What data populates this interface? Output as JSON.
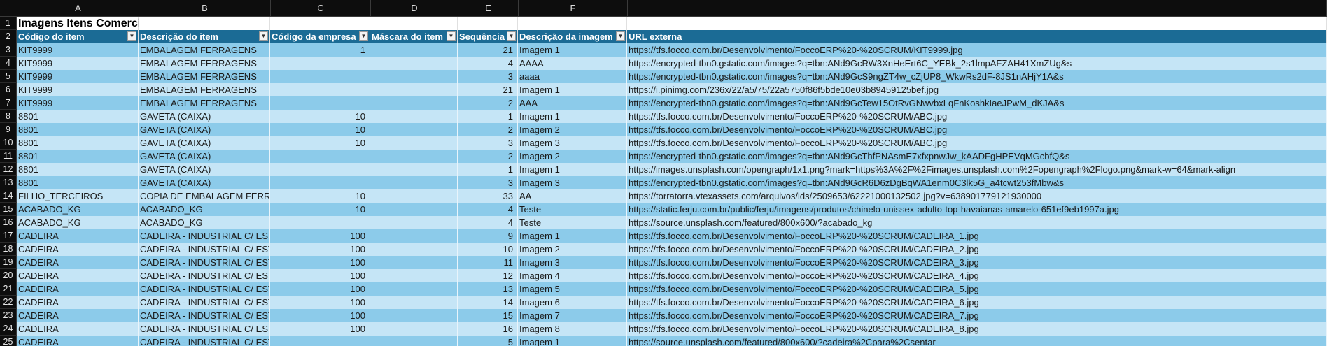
{
  "columns": [
    "A",
    "B",
    "C",
    "D",
    "E",
    "F",
    ""
  ],
  "title": "Imagens Itens Comerciais",
  "headers": [
    "Código do item",
    "Descrição do item",
    "Código da empresa",
    "Máscara do item",
    "Sequência",
    "Descrição da imagem",
    "URL externa"
  ],
  "header_dropdown_icon": "dropdown-arrow-icon",
  "colors": {
    "header_bg": "#1b6b95",
    "band_dark": "#8ccbea",
    "band_light": "#c5e5f6",
    "row_header_bg": "#0d0d0d"
  },
  "rows": [
    {
      "n": "3",
      "cells": [
        "KIT9999",
        "EMBALAGEM FERRAGENS",
        "1",
        "",
        "21",
        "Imagem 1",
        "https://tfs.focco.com.br/Desenvolvimento/FoccoERP%20-%20SCRUM/KIT9999.jpg"
      ]
    },
    {
      "n": "4",
      "cells": [
        "KIT9999",
        "EMBALAGEM FERRAGENS",
        "",
        "",
        "4",
        "AAAA",
        "https://encrypted-tbn0.gstatic.com/images?q=tbn:ANd9GcRW3XnHeErt6C_YEBk_2s1lmpAFZAH41XmZUg&s"
      ]
    },
    {
      "n": "5",
      "cells": [
        "KIT9999",
        "EMBALAGEM FERRAGENS",
        "",
        "",
        "3",
        "aaaa",
        "https://encrypted-tbn0.gstatic.com/images?q=tbn:ANd9GcS9ngZT4w_cZjUP8_WkwRs2dF-8JS1nAHjY1A&s"
      ]
    },
    {
      "n": "6",
      "cells": [
        "KIT9999",
        "EMBALAGEM FERRAGENS",
        "",
        "",
        "21",
        "Imagem 1",
        "https://i.pinimg.com/236x/22/a5/75/22a5750f86f5bde10e03b89459125bef.jpg"
      ]
    },
    {
      "n": "7",
      "cells": [
        "KIT9999",
        "EMBALAGEM FERRAGENS",
        "",
        "",
        "2",
        "AAA",
        "https://encrypted-tbn0.gstatic.com/images?q=tbn:ANd9GcTew15OtRvGNwvbxLqFnKoshkIaeJPwM_dKJA&s"
      ]
    },
    {
      "n": "8",
      "cells": [
        "8801",
        "GAVETA (CAIXA)",
        "10",
        "",
        "1",
        "Imagem 1",
        "https://tfs.focco.com.br/Desenvolvimento/FoccoERP%20-%20SCRUM/ABC.jpg"
      ]
    },
    {
      "n": "9",
      "cells": [
        "8801",
        "GAVETA (CAIXA)",
        "10",
        "",
        "2",
        "Imagem 2",
        "https://tfs.focco.com.br/Desenvolvimento/FoccoERP%20-%20SCRUM/ABC.jpg"
      ]
    },
    {
      "n": "10",
      "cells": [
        "8801",
        "GAVETA (CAIXA)",
        "10",
        "",
        "3",
        "Imagem 3",
        "https://tfs.focco.com.br/Desenvolvimento/FoccoERP%20-%20SCRUM/ABC.jpg"
      ]
    },
    {
      "n": "11",
      "cells": [
        "8801",
        "GAVETA (CAIXA)",
        "",
        "",
        "2",
        "Imagem 2",
        "https://encrypted-tbn0.gstatic.com/images?q=tbn:ANd9GcThfPNAsmE7xfxpnwJw_kAADFgHPEVqMGcbfQ&s"
      ]
    },
    {
      "n": "12",
      "cells": [
        "8801",
        "GAVETA (CAIXA)",
        "",
        "",
        "1",
        "Imagem 1",
        "https://images.unsplash.com/opengraph/1x1.png?mark=https%3A%2F%2Fimages.unsplash.com%2Fopengraph%2Flogo.png&mark-w=64&mark-align"
      ]
    },
    {
      "n": "13",
      "cells": [
        "8801",
        "GAVETA (CAIXA)",
        "",
        "",
        "3",
        "Imagem 3",
        "https://encrypted-tbn0.gstatic.com/images?q=tbn:ANd9GcR6D6zDgBqWA1enm0C3lk5G_a4tcwt253fMbw&s"
      ]
    },
    {
      "n": "14",
      "cells": [
        "FILHO_TERCEIROS",
        "COPIA DE EMBALAGEM FERRAGENS",
        "10",
        "",
        "33",
        "AA",
        "https://torratorra.vtexassets.com/arquivos/ids/2509653/62221000132502.jpg?v=638901779121930000"
      ]
    },
    {
      "n": "15",
      "cells": [
        "ACABADO_KG",
        "ACABADO_KG",
        "10",
        "",
        "4",
        "Teste",
        "https://static.ferju.com.br/public/ferju/imagens/produtos/chinelo-unissex-adulto-top-havaianas-amarelo-651ef9eb1997a.jpg"
      ]
    },
    {
      "n": "16",
      "cells": [
        "ACABADO_KG",
        "ACABADO_KG",
        "",
        "",
        "4",
        "Teste",
        "https://source.unsplash.com/featured/800x600/?acabado_kg"
      ]
    },
    {
      "n": "17",
      "cells": [
        "CADEIRA",
        "CADEIRA - INDUSTRIAL C/ ESTR",
        "100",
        "",
        "9",
        "Imagem 1",
        "https://tfs.focco.com.br/Desenvolvimento/FoccoERP%20-%20SCRUM/CADEIRA_1.jpg"
      ]
    },
    {
      "n": "18",
      "cells": [
        "CADEIRA",
        "CADEIRA - INDUSTRIAL C/ ESTR",
        "100",
        "",
        "10",
        "Imagem 2",
        "https://tfs.focco.com.br/Desenvolvimento/FoccoERP%20-%20SCRUM/CADEIRA_2.jpg"
      ]
    },
    {
      "n": "19",
      "cells": [
        "CADEIRA",
        "CADEIRA - INDUSTRIAL C/ ESTR",
        "100",
        "",
        "11",
        "Imagem 3",
        "https://tfs.focco.com.br/Desenvolvimento/FoccoERP%20-%20SCRUM/CADEIRA_3.jpg"
      ]
    },
    {
      "n": "20",
      "cells": [
        "CADEIRA",
        "CADEIRA - INDUSTRIAL C/ ESTR",
        "100",
        "",
        "12",
        "Imagem 4",
        "https://tfs.focco.com.br/Desenvolvimento/FoccoERP%20-%20SCRUM/CADEIRA_4.jpg"
      ]
    },
    {
      "n": "21",
      "cells": [
        "CADEIRA",
        "CADEIRA - INDUSTRIAL C/ ESTR",
        "100",
        "",
        "13",
        "Imagem 5",
        "https://tfs.focco.com.br/Desenvolvimento/FoccoERP%20-%20SCRUM/CADEIRA_5.jpg"
      ]
    },
    {
      "n": "22",
      "cells": [
        "CADEIRA",
        "CADEIRA - INDUSTRIAL C/ ESTR",
        "100",
        "",
        "14",
        "Imagem 6",
        "https://tfs.focco.com.br/Desenvolvimento/FoccoERP%20-%20SCRUM/CADEIRA_6.jpg"
      ]
    },
    {
      "n": "23",
      "cells": [
        "CADEIRA",
        "CADEIRA - INDUSTRIAL C/ ESTR",
        "100",
        "",
        "15",
        "Imagem 7",
        "https://tfs.focco.com.br/Desenvolvimento/FoccoERP%20-%20SCRUM/CADEIRA_7.jpg"
      ]
    },
    {
      "n": "24",
      "cells": [
        "CADEIRA",
        "CADEIRA - INDUSTRIAL C/ ESTR",
        "100",
        "",
        "16",
        "Imagem 8",
        "https://tfs.focco.com.br/Desenvolvimento/FoccoERP%20-%20SCRUM/CADEIRA_8.jpg"
      ]
    },
    {
      "n": "25",
      "cells": [
        "CADEIRA",
        "CADEIRA - INDUSTRIAL C/ ESTR",
        "",
        "",
        "5",
        "Imagem 1",
        "https://source.unsplash.com/featured/800x600/?cadeira%2Cpara%2Csentar"
      ]
    }
  ]
}
